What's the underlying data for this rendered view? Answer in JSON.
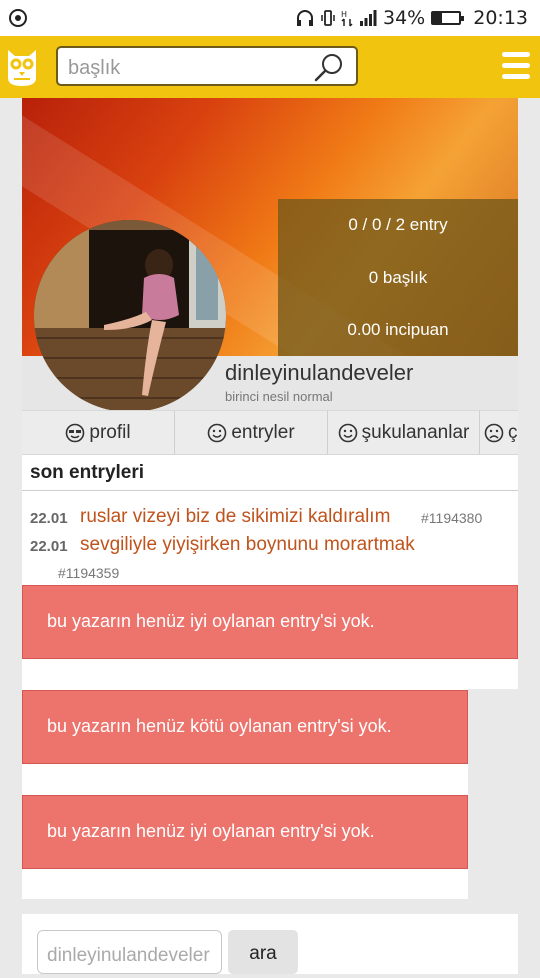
{
  "status_bar": {
    "battery": "34%",
    "time": "20:13",
    "battery_level": 0.34
  },
  "topbar": {
    "search_placeholder": "başlık"
  },
  "profile": {
    "stats": {
      "entries": "0 / 0 / 2 entry",
      "titles": "0 başlık",
      "points": "0.00 incipuan"
    },
    "username": "dinleyinulandeveler",
    "level": "birinci nesil normal"
  },
  "tabs": [
    {
      "label": "profil",
      "icon": "cool-face-icon"
    },
    {
      "label": "entryler",
      "icon": "smile-icon"
    },
    {
      "label": "şukulananlar",
      "icon": "smile-icon"
    },
    {
      "label": "ç",
      "icon": "sad-face-icon"
    }
  ],
  "recent": {
    "title": "son entryleri",
    "entries": [
      {
        "date": "22.01",
        "title": "ruslar vizeyi biz de sikimizi kaldıralım",
        "id": "#1194380"
      },
      {
        "date": "22.01",
        "title": "sevgiliyle yiyişirken boynunu morartmak",
        "id": "#1194359"
      }
    ]
  },
  "alerts": [
    "bu yazarın henüz iyi oylanan entry'si yok.",
    "bu yazarın henüz kötü oylanan entry'si yok.",
    "bu yazarın henüz iyi oylanan entry'si yok."
  ],
  "bottom": {
    "input_value": "dinleyinulandeveler",
    "button": "ara"
  }
}
